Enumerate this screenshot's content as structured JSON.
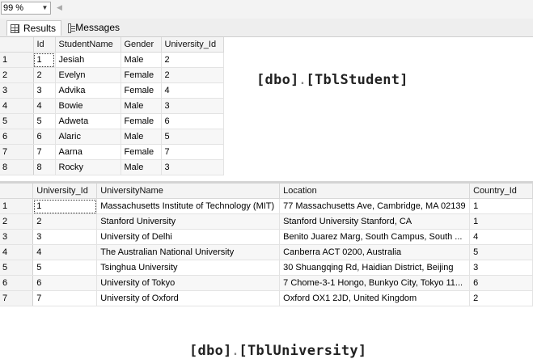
{
  "toolbar": {
    "zoom_value": "99 %",
    "zoom_arrow": "▼",
    "scroll_left_arrow": "◀"
  },
  "tabs": [
    {
      "label": "Results",
      "icon": "grid-icon",
      "active": true
    },
    {
      "label": "Messages",
      "icon": "messages-icon",
      "active": false
    }
  ],
  "student_grid": {
    "caption": {
      "schema": "[dbo]",
      "dot": ".",
      "table": "[TblStudent]"
    },
    "columns": [
      "Id",
      "StudentName",
      "Gender",
      "University_Id"
    ],
    "rows": [
      [
        "1",
        "1",
        "Jesiah",
        "Male",
        "2"
      ],
      [
        "2",
        "2",
        "Evelyn",
        "Female",
        "2"
      ],
      [
        "3",
        "3",
        "Advika",
        "Female",
        "4"
      ],
      [
        "4",
        "4",
        "Bowie",
        "Male",
        "3"
      ],
      [
        "5",
        "5",
        "Adweta",
        "Female",
        "6"
      ],
      [
        "6",
        "6",
        "Alaric",
        "Male",
        "5"
      ],
      [
        "7",
        "7",
        "Aarna",
        "Female",
        "7"
      ],
      [
        "8",
        "8",
        "Rocky",
        "Male",
        "3"
      ]
    ]
  },
  "university_grid": {
    "caption": {
      "schema": "[dbo]",
      "dot": ".",
      "table": "[TblUniversity]"
    },
    "columns": [
      "University_Id",
      "UniversityName",
      "Location",
      "Country_Id"
    ],
    "rows": [
      [
        "1",
        "1",
        "Massachusetts Institute of Technology (MIT)",
        "77 Massachusetts Ave, Cambridge, MA 02139",
        "1"
      ],
      [
        "2",
        "2",
        "Stanford University",
        " Stanford University Stanford, CA",
        "1"
      ],
      [
        "3",
        "3",
        "University of Delhi",
        "Benito Juarez Marg, South Campus, South ...",
        "4"
      ],
      [
        "4",
        "4",
        "The Australian National University",
        "Canberra ACT 0200, Australia",
        "5"
      ],
      [
        "5",
        "5",
        "Tsinghua University",
        "30 Shuangqing Rd, Haidian District, Beijing",
        "3"
      ],
      [
        "6",
        "6",
        "University of Tokyo",
        "7 Chome-3-1 Hongo, Bunkyo City, Tokyo 11...",
        "6"
      ],
      [
        "7",
        "7",
        "University of Oxford",
        " Oxford OX1 2JD, United Kingdom",
        "2"
      ]
    ]
  }
}
